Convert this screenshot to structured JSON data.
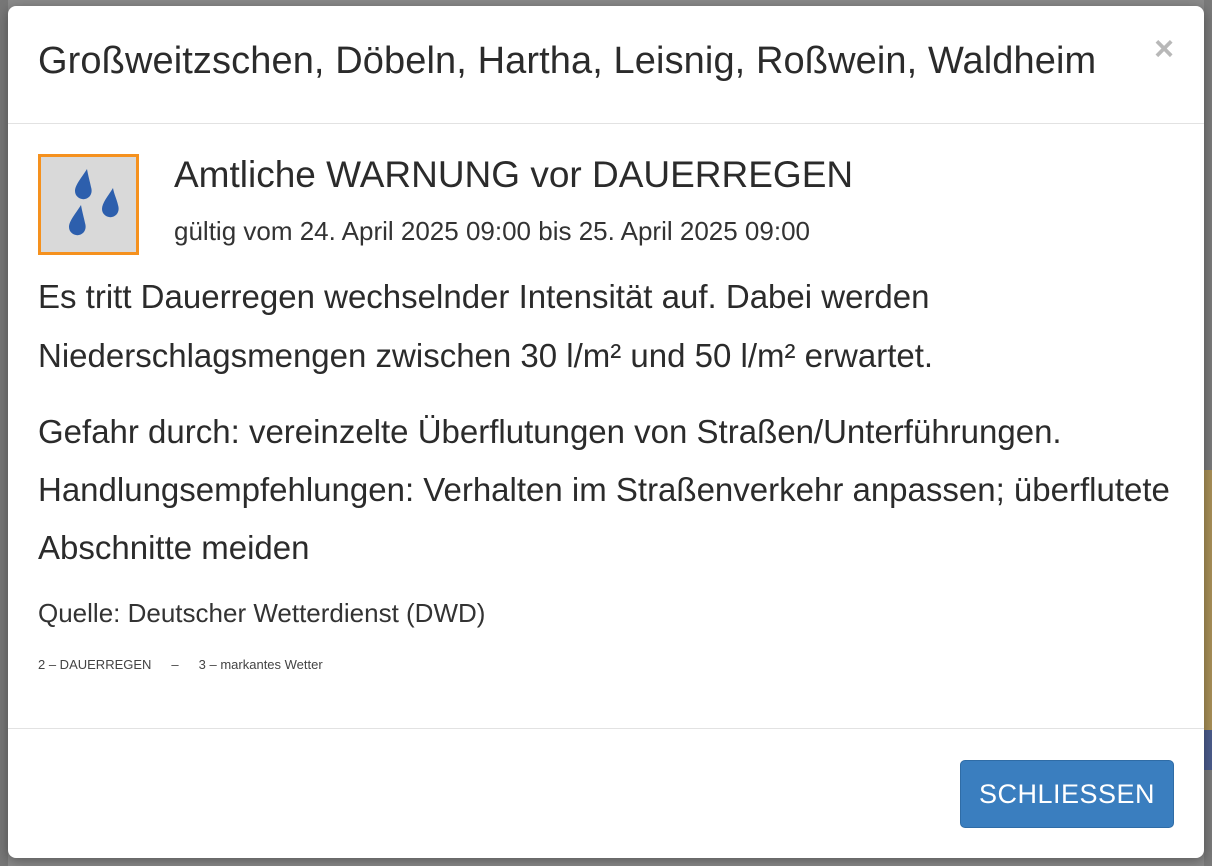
{
  "modal": {
    "title": "Großweitzschen, Döbeln, Hartha, Leisnig, Roßwein, Waldheim",
    "close_icon": "×"
  },
  "warning": {
    "icon": "rain-drops-icon",
    "icon_border_color": "#f5911e",
    "icon_bg_color": "#d9d9d9",
    "drop_color": "#2d5fad",
    "title": "Amtliche WARNUNG vor DAUERREGEN",
    "validity": "gültig vom 24. April 2025 09:00 bis 25. April 2025 09:00",
    "description": "Es tritt Dauerregen wechselnder Intensität auf. Dabei werden Niederschlagsmengen zwischen 30 l/m² und 50 l/m² erwartet.",
    "instruction": "Gefahr durch: vereinzelte Überflutungen von Straßen/Unterführungen. Handlungsempfehlungen: Verhalten im Straßenverkehr anpassen; überflutete Abschnitte meiden",
    "source": "Quelle: Deutscher Wetterdienst (DWD)",
    "event_code": "2 – DAUERREGEN",
    "separator": "–",
    "level": "3 – markantes Wetter"
  },
  "footer": {
    "close_label": "SCHLIESSEN",
    "button_color": "#3a7ebf"
  }
}
